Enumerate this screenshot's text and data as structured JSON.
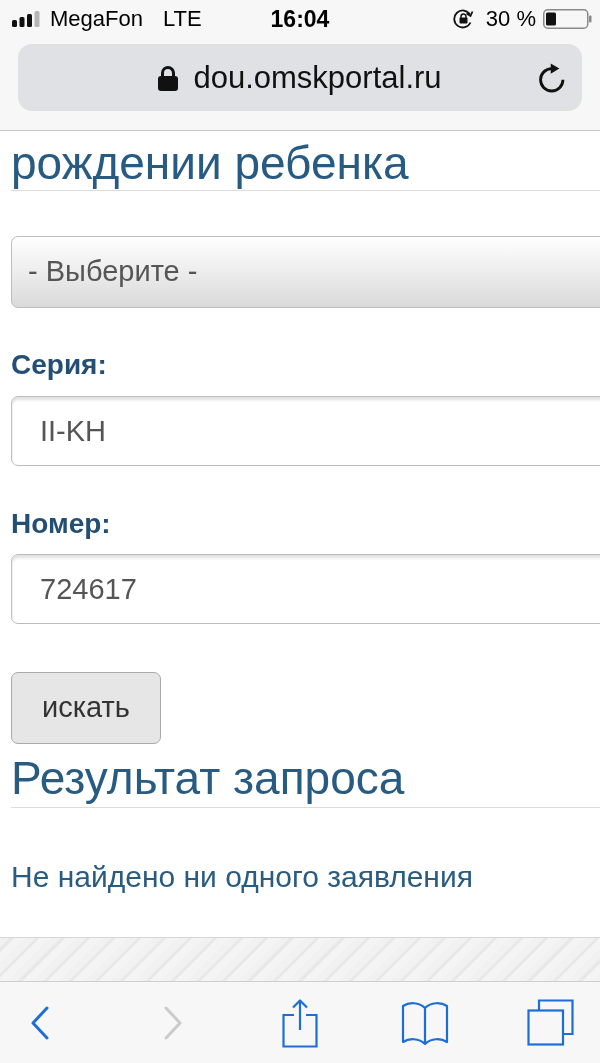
{
  "status_bar": {
    "carrier": "MegaFon",
    "network": "LTE",
    "time": "16:04",
    "battery_percent": "30 %"
  },
  "address_bar": {
    "url": "dou.omskportal.ru",
    "secure": true
  },
  "form": {
    "heading": "рождении ребенка",
    "dropdown": {
      "value": "- Выберите -"
    },
    "fields": [
      {
        "label": "Серия:",
        "value": "II-KH"
      },
      {
        "label": "Номер:",
        "value": "724617"
      }
    ],
    "submit_button": "искать"
  },
  "result": {
    "heading": "Результат запроса",
    "message": "Не найдено ни одного заявления"
  },
  "toolbar": [
    {
      "kind": "back",
      "disabled": false
    },
    {
      "kind": "forward",
      "disabled": true
    },
    {
      "kind": "share",
      "disabled": false
    },
    {
      "kind": "bookmarks",
      "disabled": false
    },
    {
      "kind": "tabs",
      "disabled": false
    }
  ]
}
